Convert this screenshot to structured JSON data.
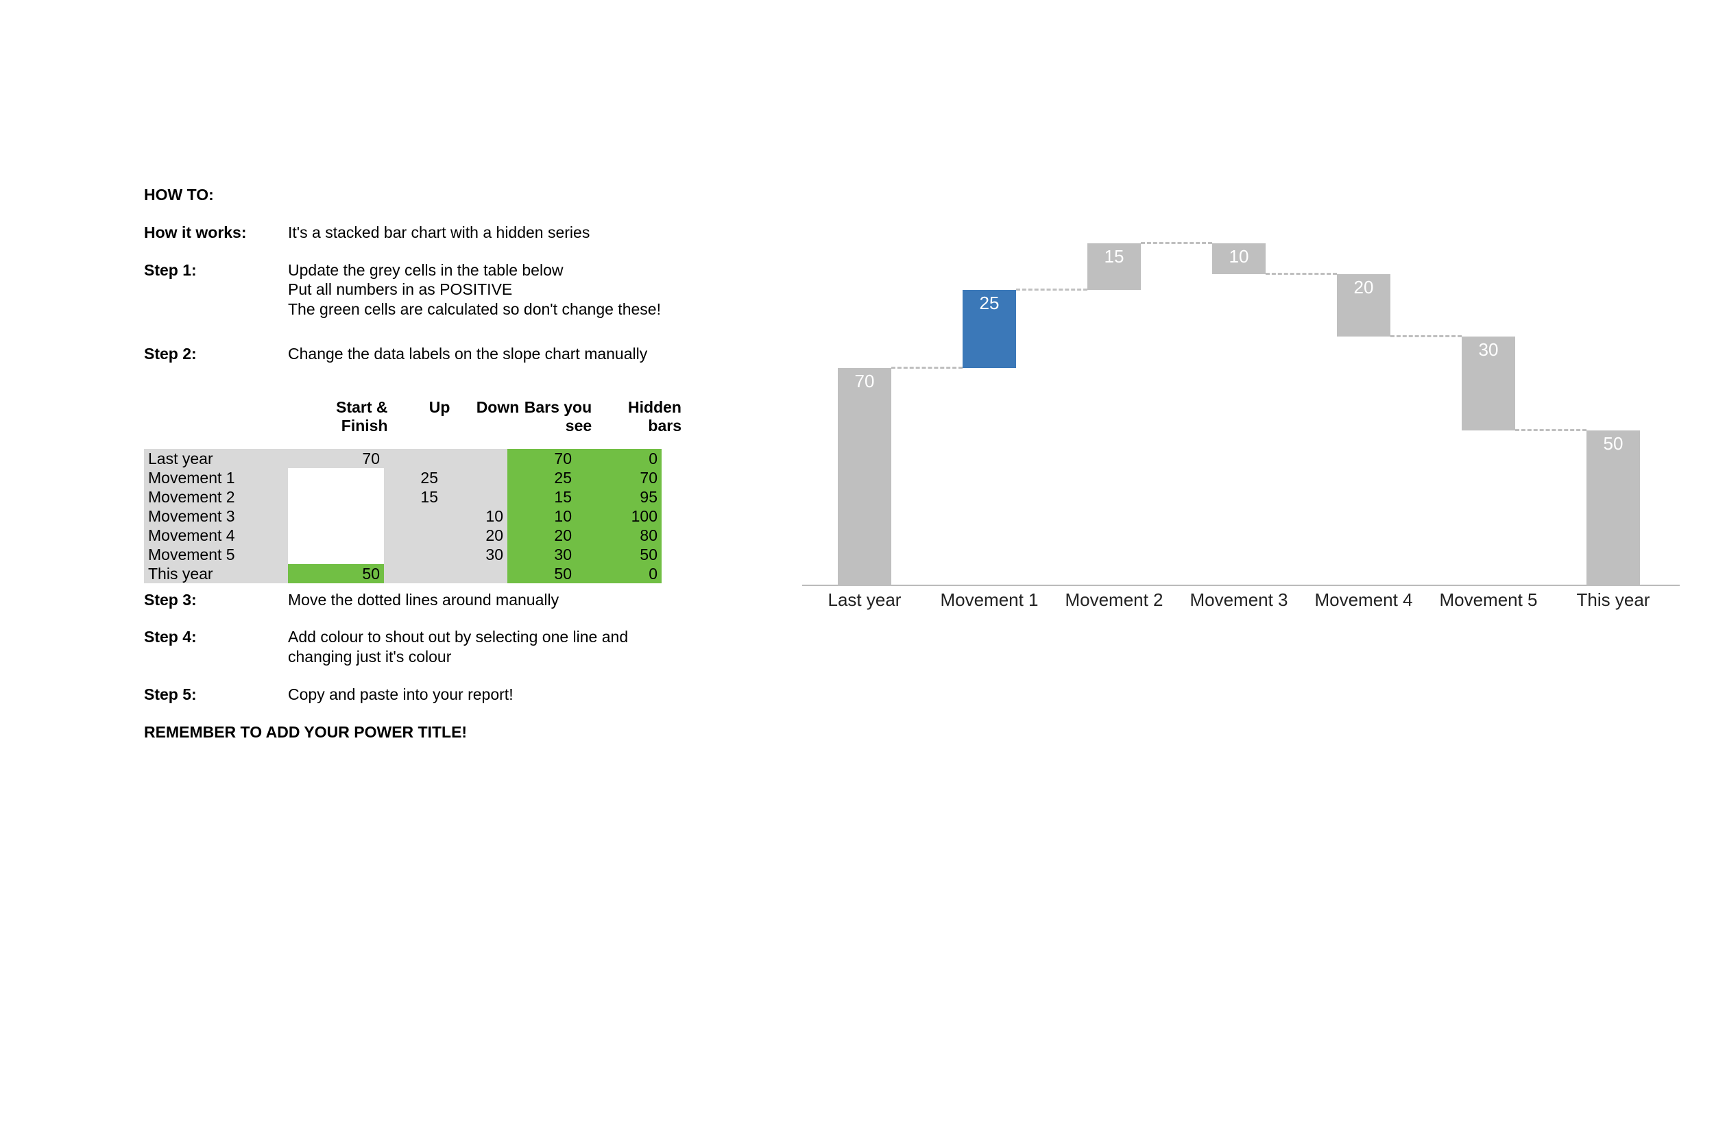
{
  "howto_title": "HOW TO:",
  "how_label": "How it works:",
  "how_text": "It's a stacked bar chart with a hidden series",
  "step1_label": "Step 1:",
  "step1_line1": "Update the grey cells in the table below",
  "step1_line2": "Put all numbers in as POSITIVE",
  "step1_line3": "The green cells are calculated so don't change these!",
  "step2_label": "Step 2:",
  "step2_text": "Change the data labels on the slope chart manually",
  "step3_label": "Step 3:",
  "step3_text": "Move the dotted lines around manually",
  "step4_label": "Step 4:",
  "step4_text": "Add colour to shout out by selecting one line and changing just it's colour",
  "step5_label": "Step 5:",
  "step5_text": "Copy and paste into your report!",
  "remember": "REMEMBER TO ADD YOUR POWER TITLE!",
  "table": {
    "headers": {
      "start_finish": "Start & Finish",
      "up": "Up",
      "down": "Down",
      "bars_you_see": "Bars you see",
      "hidden_bars": "Hidden bars"
    },
    "rows": [
      {
        "label": "Last year",
        "start_finish": "70",
        "up": "",
        "down": "",
        "bars": "70",
        "hidden": "0",
        "sf_bg": "grey"
      },
      {
        "label": "Movement 1",
        "start_finish": "",
        "up": "25",
        "down": "",
        "bars": "25",
        "hidden": "70",
        "sf_bg": "white"
      },
      {
        "label": "Movement 2",
        "start_finish": "",
        "up": "15",
        "down": "",
        "bars": "15",
        "hidden": "95",
        "sf_bg": "white"
      },
      {
        "label": "Movement 3",
        "start_finish": "",
        "up": "",
        "down": "10",
        "bars": "10",
        "hidden": "100",
        "sf_bg": "white"
      },
      {
        "label": "Movement 4",
        "start_finish": "",
        "up": "",
        "down": "20",
        "bars": "20",
        "hidden": "80",
        "sf_bg": "white"
      },
      {
        "label": "Movement 5",
        "start_finish": "",
        "up": "",
        "down": "30",
        "bars": "30",
        "hidden": "50",
        "sf_bg": "white"
      },
      {
        "label": "This year",
        "start_finish": "50",
        "up": "",
        "down": "",
        "bars": "50",
        "hidden": "0",
        "sf_bg": "green"
      }
    ]
  },
  "chart_data": {
    "type": "bar",
    "description": "Waterfall chart (stacked bar with hidden base series)",
    "categories": [
      "Last year",
      "Movement 1",
      "Movement 2",
      "Movement 3",
      "Movement 4",
      "Movement 5",
      "This year"
    ],
    "series": [
      {
        "name": "Hidden bars",
        "values": [
          0,
          70,
          95,
          100,
          80,
          50,
          0
        ],
        "role": "invisible-base"
      },
      {
        "name": "Bars you see",
        "values": [
          70,
          25,
          15,
          10,
          20,
          30,
          50
        ],
        "role": "visible"
      }
    ],
    "bar_labels": [
      70,
      25,
      15,
      10,
      20,
      30,
      50
    ],
    "highlight_index": 1,
    "colors": {
      "default": "#bfbfbf",
      "highlight": "#3b78b8",
      "label_text": "#ffffff"
    },
    "connectors": [
      {
        "from": 0,
        "to": 1,
        "y": 70
      },
      {
        "from": 1,
        "to": 2,
        "y": 95
      },
      {
        "from": 2,
        "to": 3,
        "y": 110
      },
      {
        "from": 3,
        "to": 4,
        "y": 100
      },
      {
        "from": 4,
        "to": 5,
        "y": 80
      },
      {
        "from": 5,
        "to": 6,
        "y": 50
      }
    ],
    "ylim": [
      0,
      110
    ]
  }
}
